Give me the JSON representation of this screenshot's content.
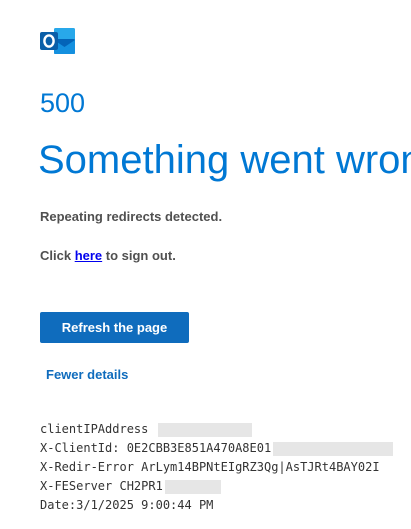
{
  "brand": {
    "logo_icon": "outlook-icon"
  },
  "error": {
    "code": "500",
    "headline": "Something went wrong",
    "message": "Repeating redirects detected."
  },
  "signout": {
    "prefix": "Click ",
    "link_label": "here",
    "suffix": " to sign out."
  },
  "actions": {
    "refresh_label": "Refresh the page",
    "fewer_details_label": "Fewer details"
  },
  "details": {
    "client_ip": "clientIPAddress",
    "client_id": "X-ClientId: 0E2CBB3E851A470A8E01",
    "redir_error": "X-Redir-Error ArLym14BPNtEIgRZ3Qg|AsTJRt4BAY02I",
    "fe_server": "X-FEServer CH2PR1",
    "date": "Date:3/1/2025 9:00:44 PM"
  },
  "colors": {
    "accent": "#0078d4",
    "button": "#0f6cbd",
    "link": "#0000ee"
  }
}
